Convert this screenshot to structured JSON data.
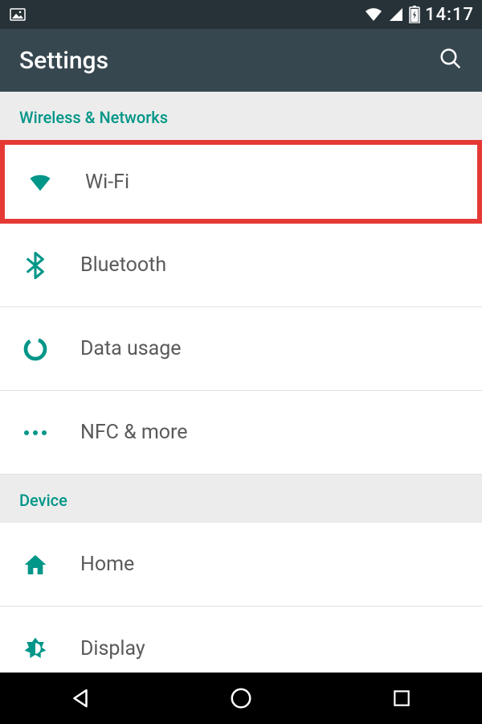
{
  "status": {
    "time": "14:17"
  },
  "toolbar": {
    "title": "Settings"
  },
  "sections": {
    "wireless_header": "Wireless & Networks",
    "device_header": "Device"
  },
  "items": {
    "wifi": "Wi-Fi",
    "bluetooth": "Bluetooth",
    "data_usage": "Data usage",
    "nfc_more": "NFC & more",
    "home": "Home",
    "display": "Display"
  },
  "colors": {
    "accent": "#009688",
    "highlight": "#E53935"
  }
}
